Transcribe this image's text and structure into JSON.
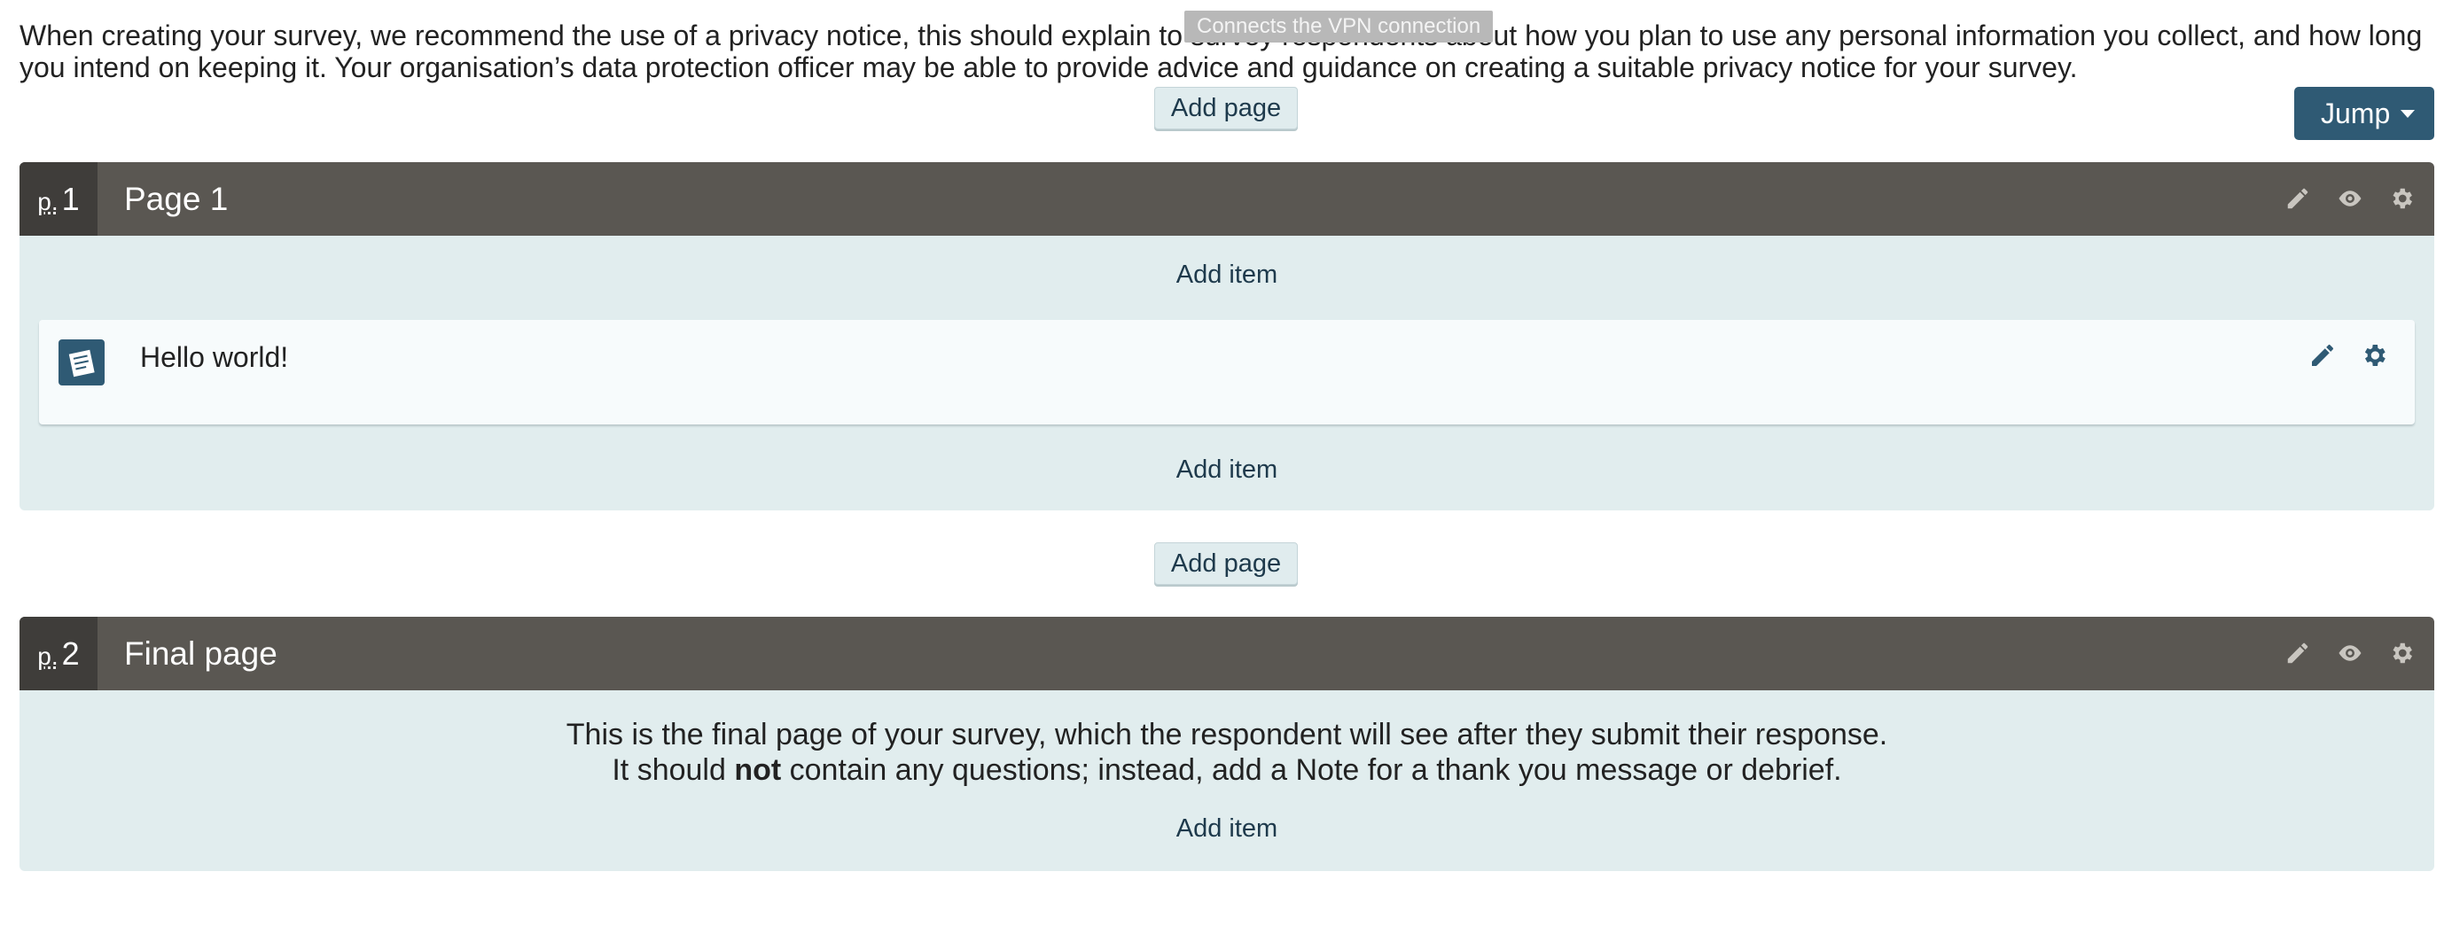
{
  "intro": {
    "text": "When creating your survey, we recommend the use of a privacy notice, this should explain to survey respondents about how you plan to use any personal information you collect, and how long you intend on keeping it. Your organisation’s data protection officer may be able to provide advice and guidance on creating a suitable privacy notice for your survey."
  },
  "tooltip": {
    "text": "Connects the VPN connection"
  },
  "toolbar": {
    "jump_label": "Jump",
    "add_page_label": "Add page"
  },
  "pages": [
    {
      "prefix": "p.",
      "number": "1",
      "title": "Page 1",
      "add_item_label": "Add item",
      "items": [
        {
          "text": "Hello world!",
          "type_icon": "note-icon"
        }
      ]
    },
    {
      "prefix": "p.",
      "number": "2",
      "title": "Final page",
      "add_item_label": "Add item",
      "description_line1": "This is the final page of your survey, which the respondent will see after they submit their response.",
      "description_line2_before": "It should ",
      "description_line2_bold": "not",
      "description_line2_after": " contain any questions; instead, add a Note for a thank you message or debrief."
    }
  ],
  "icons": {
    "header": [
      "pencil-icon",
      "eye-icon",
      "gear-icon"
    ],
    "item": [
      "pencil-icon",
      "gear-icon"
    ]
  },
  "colors": {
    "header_bg": "#5a5752",
    "page_body_bg": "#e1edee",
    "accent": "#2f5a74"
  }
}
